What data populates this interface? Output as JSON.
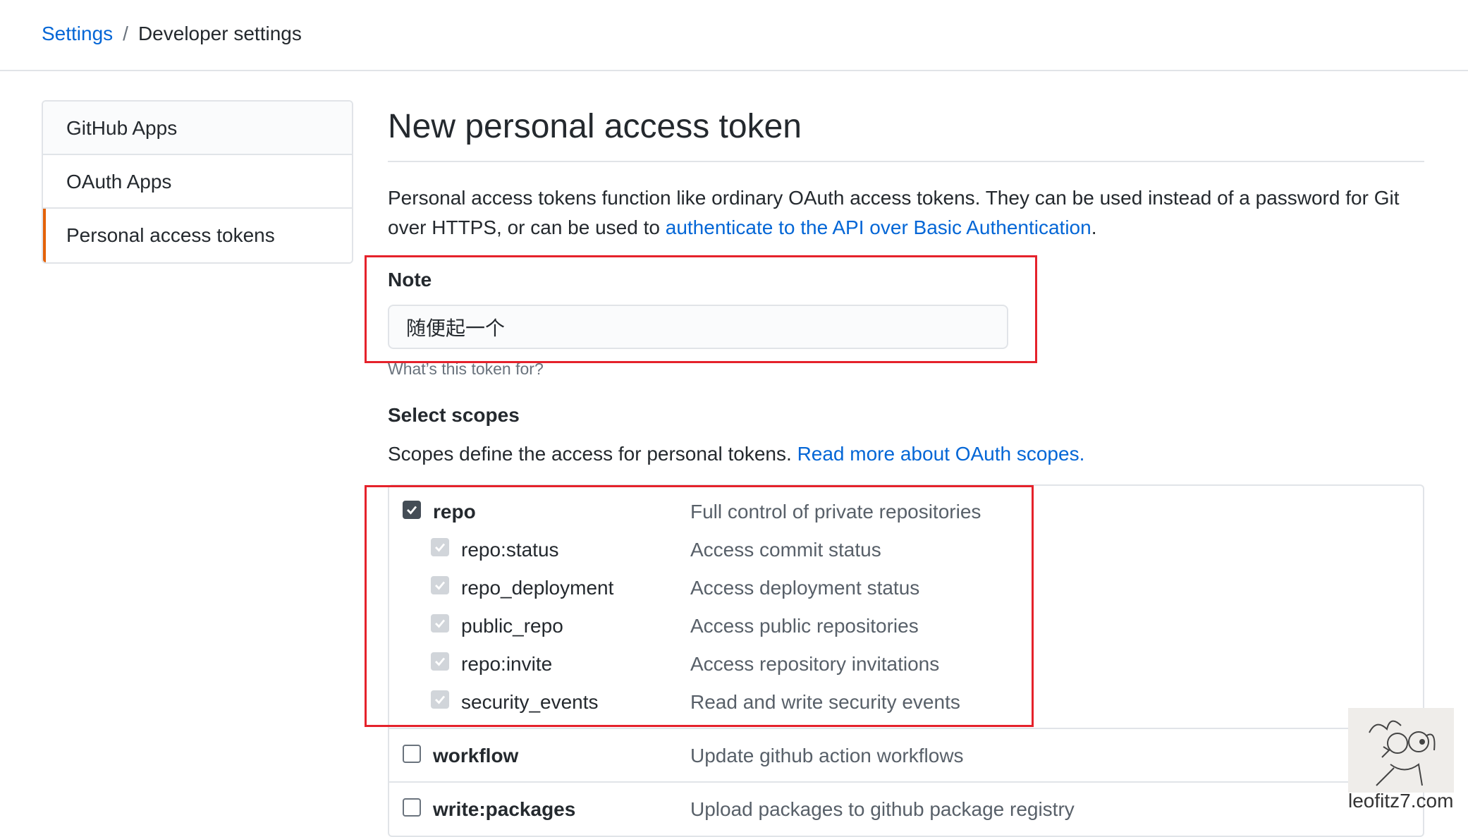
{
  "breadcrumb": {
    "root": "Settings",
    "separator": "/",
    "current": "Developer settings"
  },
  "sidebar": {
    "items": [
      {
        "label": "GitHub Apps"
      },
      {
        "label": "OAuth Apps"
      },
      {
        "label": "Personal access tokens"
      }
    ]
  },
  "main": {
    "title": "New personal access token",
    "intro_text": "Personal access tokens function like ordinary OAuth access tokens. They can be used instead of a password for Git over HTTPS, or can be used to ",
    "intro_link": "authenticate to the API over Basic Authentication",
    "intro_end": "."
  },
  "note": {
    "label": "Note",
    "value": "随便起一个",
    "hint": "What’s this token for?"
  },
  "scopes": {
    "title": "Select scopes",
    "desc_text": "Scopes define the access for personal tokens. ",
    "desc_link": "Read more about OAuth scopes.",
    "items": [
      {
        "name": "repo",
        "desc": "Full control of private repositories",
        "checked": true
      },
      {
        "name": "repo:status",
        "desc": "Access commit status",
        "checked": true
      },
      {
        "name": "repo_deployment",
        "desc": "Access deployment status",
        "checked": true
      },
      {
        "name": "public_repo",
        "desc": "Access public repositories",
        "checked": true
      },
      {
        "name": "repo:invite",
        "desc": "Access repository invitations",
        "checked": true
      },
      {
        "name": "security_events",
        "desc": "Read and write security events",
        "checked": true
      },
      {
        "name": "workflow",
        "desc": "Update github action workflows",
        "checked": false
      },
      {
        "name": "write:packages",
        "desc": "Upload packages to github package registry",
        "checked": false
      }
    ]
  },
  "watermark": {
    "text": "leofitz7.com"
  },
  "colors": {
    "link": "#0366d6",
    "highlight_box": "#e5222b",
    "active_tab": "#e36209"
  }
}
